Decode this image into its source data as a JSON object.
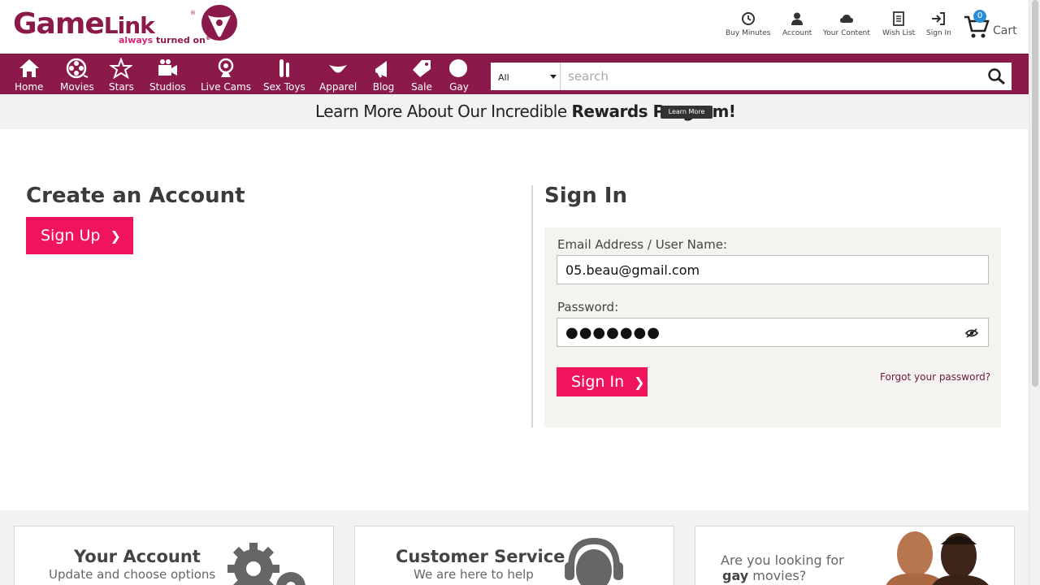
{
  "brand": {
    "name_big": "Game",
    "name_small": "Link",
    "reg": "®",
    "tagline_a": "always",
    "tagline_b": "turned on",
    "tagline_tm": "®",
    "color": "#8b1a4a"
  },
  "utility": {
    "buy_minutes": "Buy Minutes",
    "account": "Account",
    "your_content": "Your Content",
    "wish_list": "Wish List",
    "sign_in": "Sign In",
    "cart_label": "Cart",
    "cart_count": "0"
  },
  "nav": {
    "items": [
      {
        "label": "Home",
        "icon": "home-icon"
      },
      {
        "label": "Movies",
        "icon": "film-reel-icon"
      },
      {
        "label": "Stars",
        "icon": "star-icon"
      },
      {
        "label": "Studios",
        "icon": "video-camera-icon"
      },
      {
        "label": "Live Cams",
        "icon": "webcam-icon"
      },
      {
        "label": "Sex Toys",
        "icon": "toys-icon"
      },
      {
        "label": "Apparel",
        "icon": "apparel-icon"
      },
      {
        "label": "Blog",
        "icon": "megaphone-icon"
      },
      {
        "label": "Sale",
        "icon": "tag-icon"
      },
      {
        "label": "Gay",
        "icon": "circle-icon"
      }
    ]
  },
  "search": {
    "category": "All",
    "placeholder": "search"
  },
  "promo": {
    "text_plain": "Learn More About Our Incredible ",
    "text_bold": "Rewards Program!",
    "button": "Learn More"
  },
  "create": {
    "title": "Create an Account",
    "button": "Sign Up"
  },
  "signin": {
    "title": "Sign In",
    "email_label": "Email Address / User Name:",
    "email_value": "05.beau@gmail.com",
    "password_label": "Password:",
    "password_value": "●●●●●●●",
    "button": "Sign In",
    "forgot": "Forgot your password?"
  },
  "cards": {
    "account_title": "Your Account",
    "account_sub": "Update and choose options",
    "service_title": "Customer Service",
    "service_sub": "We are here to help",
    "gay_line1": "Are you looking for",
    "gay_bold": "gay",
    "gay_rest": " movies?"
  },
  "colors": {
    "nav_bg": "#8b1a4a",
    "cta_pink": "#f0145c",
    "cart_badge": "#2b8fd8"
  }
}
